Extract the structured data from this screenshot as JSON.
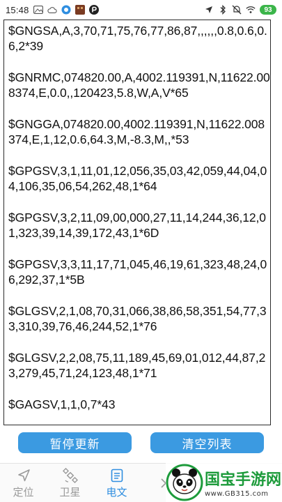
{
  "status_bar": {
    "time": "15:48",
    "battery": "93",
    "left_icons": [
      "photo-icon",
      "cloud-icon",
      "browser-icon",
      "app-icon",
      "p-icon"
    ],
    "right_icons": [
      "location-icon",
      "bluetooth-icon",
      "mute-icon",
      "wifi-icon",
      "battery-icon"
    ]
  },
  "messages": [
    "$GNGSA,A,3,70,71,75,76,77,86,87,,,,,,0.8,0.6,0.6,2*39",
    "$GNRMC,074820.00,A,4002.119391,N,11622.008374,E,0.0,,120423,5.8,W,A,V*65",
    "$GNGGA,074820.00,4002.119391,N,11622.008374,E,1,12,0.6,64.3,M,-8.3,M,,*53",
    "$GPGSV,3,1,11,01,12,056,35,03,42,059,44,04,04,106,35,06,54,262,48,1*64",
    "$GPGSV,3,2,11,09,00,000,27,11,14,244,36,12,01,323,39,14,39,172,43,1*6D",
    "$GPGSV,3,3,11,17,71,045,46,19,61,323,48,24,06,292,37,1*5B",
    "$GLGSV,2,1,08,70,31,066,38,86,58,351,54,77,33,310,39,76,46,244,52,1*76",
    "$GLGSV,2,2,08,75,11,189,45,69,01,012,44,87,23,279,45,71,24,123,48,1*71",
    "$GAGSV,1,1,0,7*43"
  ],
  "buttons": {
    "pause": "暂停更新",
    "clear": "清空列表"
  },
  "nav": {
    "tabs": [
      {
        "label": "定位",
        "icon": "navigation-icon",
        "active": false
      },
      {
        "label": "卫星",
        "icon": "satellite-icon",
        "active": false
      },
      {
        "label": "电文",
        "icon": "document-icon",
        "active": true
      }
    ]
  },
  "watermark": {
    "title": "国宝手游网",
    "url": "www.GB315.com"
  },
  "colors": {
    "accent": "#3b9ae1",
    "nav_active": "#2f8ee0",
    "nav_inactive": "#9a9a9a",
    "battery": "#3bb54a",
    "watermark_green": "#1d9b3b"
  }
}
